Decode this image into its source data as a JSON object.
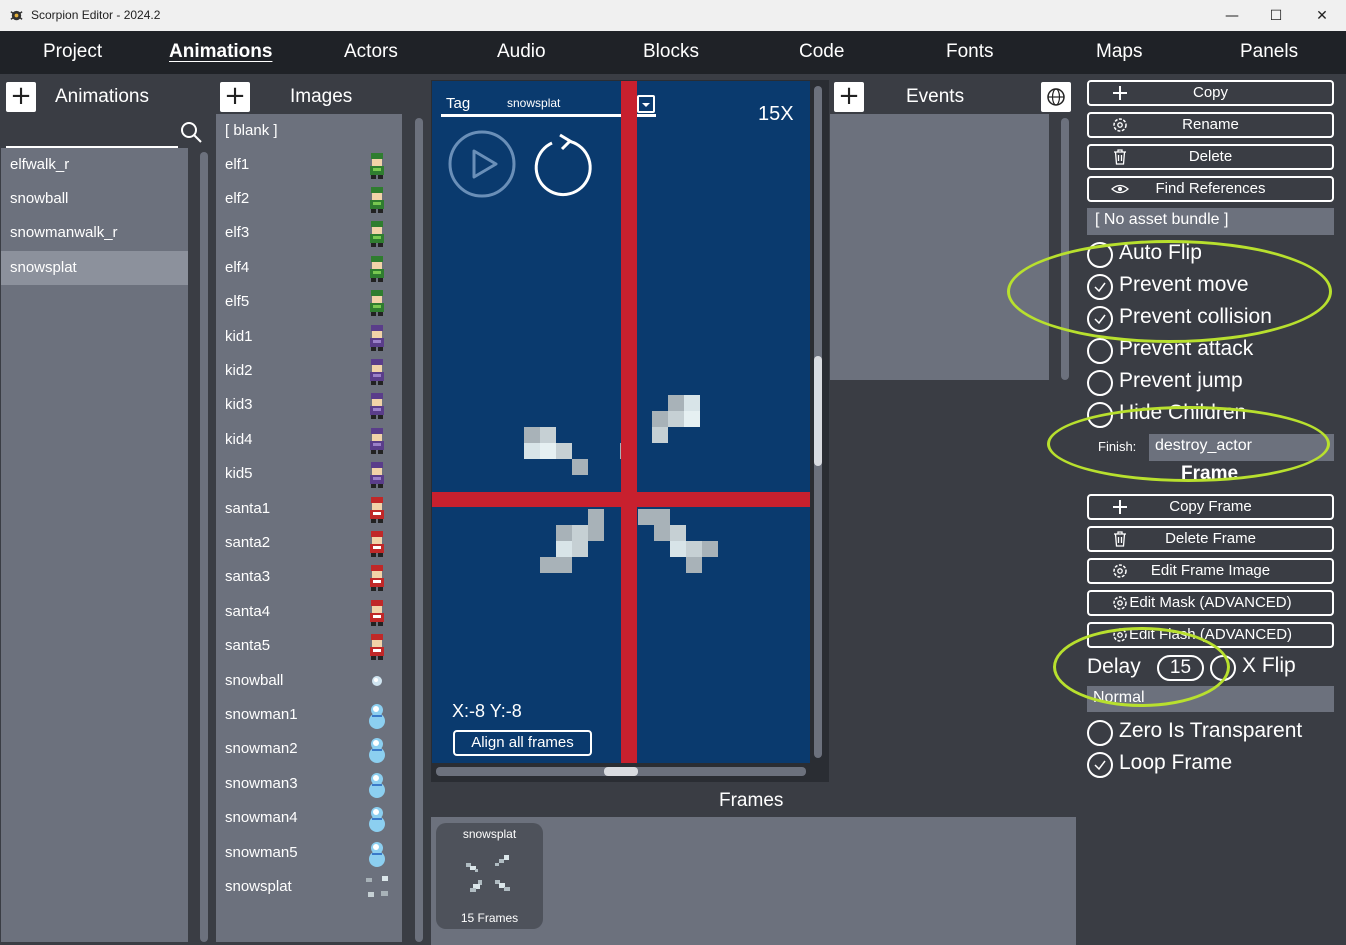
{
  "window": {
    "title": "Scorpion Editor - 2024.2",
    "minimize": "—",
    "maximize": "☐",
    "close": "✕"
  },
  "menu": [
    "Project",
    "Animations",
    "Actors",
    "Audio",
    "Blocks",
    "Code",
    "Fonts",
    "Maps",
    "Panels"
  ],
  "animations": {
    "label": "Animations",
    "search_value": "",
    "items": [
      "elfwalk_r",
      "snowball",
      "snowmanwalk_r",
      "snowsplat"
    ],
    "selected": "snowsplat"
  },
  "images": {
    "label": "Images",
    "items": [
      "[ blank ]",
      "elf1",
      "elf2",
      "elf3",
      "elf4",
      "elf5",
      "kid1",
      "kid2",
      "kid3",
      "kid4",
      "kid5",
      "santa1",
      "santa2",
      "santa3",
      "santa4",
      "santa5",
      "snowball",
      "snowman1",
      "snowman2",
      "snowman3",
      "snowman4",
      "snowman5",
      "snowsplat"
    ]
  },
  "canvas": {
    "tag_label": "Tag",
    "tag_value": "snowsplat",
    "zoom": "15X",
    "coords": "X:-8 Y:-8",
    "align_button": "Align all frames"
  },
  "events": {
    "label": "Events"
  },
  "right": {
    "copy": "Copy",
    "rename": "Rename",
    "delete": "Delete",
    "find_refs": "Find References",
    "asset_bundle": "[ No asset bundle ]",
    "checks": [
      {
        "label": "Auto Flip",
        "checked": false
      },
      {
        "label": "Prevent move",
        "checked": true
      },
      {
        "label": "Prevent collision",
        "checked": true
      },
      {
        "label": "Prevent attack",
        "checked": false
      },
      {
        "label": "Prevent jump",
        "checked": false
      },
      {
        "label": "Hide Children",
        "checked": false
      }
    ],
    "finish_label": "Finish:",
    "finish_value": "destroy_actor",
    "frame_heading": "Frame",
    "copy_frame": "Copy Frame",
    "delete_frame": "Delete Frame",
    "edit_frame_image": "Edit Frame Image",
    "edit_mask": "Edit Mask (ADVANCED)",
    "edit_flash": "Edit Flash (ADVANCED)",
    "delay_label": "Delay",
    "delay_value": "15",
    "xflip_label": "X Flip",
    "blend_mode": "Normal",
    "zero_transparent": "Zero Is Transparent",
    "loop_frame": "Loop Frame"
  },
  "frames": {
    "label": "Frames",
    "card_title": "snowsplat",
    "card_count": "15 Frames"
  },
  "colors": {
    "accent_highlight": "#b8e02e",
    "canvas_bg": "#0a3a6e",
    "crosshair": "#c8202e"
  }
}
